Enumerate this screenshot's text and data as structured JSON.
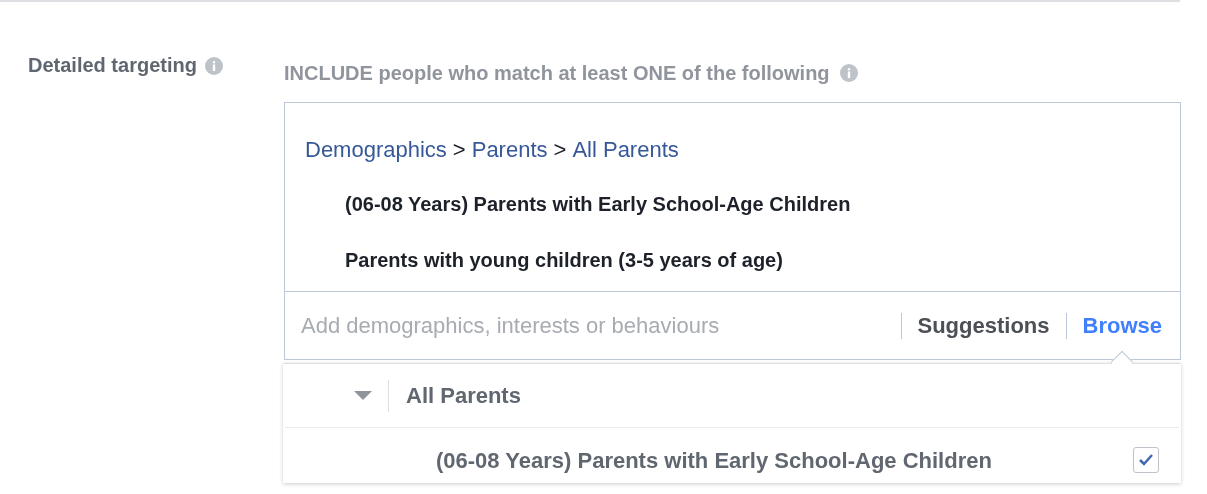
{
  "label": "Detailed targeting",
  "instruction": "INCLUDE people who match at least ONE of the following",
  "breadcrumb": {
    "links": [
      "Demographics",
      "Parents",
      "All Parents"
    ],
    "separator": ">"
  },
  "selected_items": [
    "(06-08 Years) Parents with Early School-Age Children",
    "Parents with young children (3-5 years of age)"
  ],
  "search": {
    "placeholder": "Add demographics, interests or behaviours"
  },
  "tabs": [
    {
      "label": "Suggestions",
      "selected": false
    },
    {
      "label": "Browse",
      "selected": true
    }
  ],
  "browse_panel": {
    "category": {
      "label": "All Parents",
      "expanded": true
    },
    "items": [
      {
        "label": "(06-08 Years) Parents with Early School-Age Children",
        "checked": true
      }
    ]
  }
}
